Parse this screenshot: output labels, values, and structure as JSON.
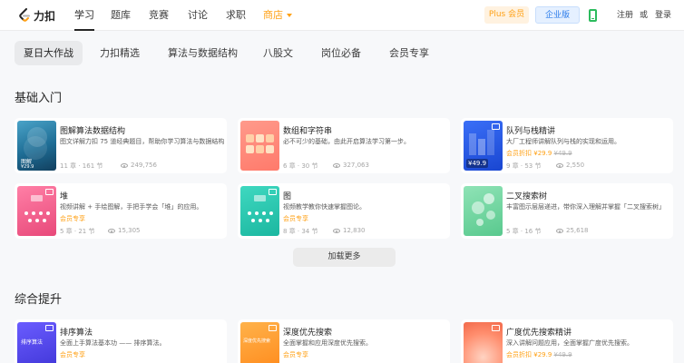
{
  "brand": {
    "name": "力扣"
  },
  "nav": {
    "items": [
      "学习",
      "题库",
      "竞赛",
      "讨论",
      "求职"
    ],
    "shop_label": "商店",
    "plus_label": "Plus 会员",
    "enterprise_label": "企业版",
    "register_label": "注册",
    "or_label": "或",
    "login_label": "登录"
  },
  "tabs": [
    "夏日大作战",
    "力扣精选",
    "算法与数据结构",
    "八股文",
    "岗位必备",
    "会员专享"
  ],
  "sections": {
    "basics_title": "基础入门",
    "advanced_title": "综合提升",
    "load_more_label": "加载更多"
  },
  "cards_basics": [
    {
      "title": "图解算法数据结构",
      "desc": "图文详解力扣 75 道经典题目，帮助你学习算法与数据结构",
      "meta": "11 章 · 161 节",
      "views": "249,756",
      "thumb_label": "图解",
      "thumb_price": "¥29.9"
    },
    {
      "title": "数组和字符串",
      "desc": "必不可少的基础，由此开启算法学习第一步。",
      "meta": "6 章 · 30 节",
      "views": "327,063"
    },
    {
      "title": "队列与栈精讲",
      "desc": "大厂工程师讲解队列与栈的实现和运用。",
      "tag_prefix": "会员折扣 ",
      "tag_price": "¥29.9",
      "tag_old": "¥49.9",
      "meta": "9 章 · 53 节",
      "views": "2,550",
      "thumb_price": "¥49.9"
    },
    {
      "title": "堆",
      "desc": "视频讲解 + 手绘图解，手把手学会「堆」的应用。",
      "tag": "会员专享",
      "meta": "5 章 · 21 节",
      "views": "15,305"
    },
    {
      "title": "图",
      "desc": "视频教学教你快速掌握图论。",
      "tag": "会员专享",
      "meta": "8 章 · 34 节",
      "views": "12,830"
    },
    {
      "title": "二叉搜索树",
      "desc": "丰富图示层层递进，带你深入理解并掌握「二叉搜索树」",
      "meta": "5 章 · 16 节",
      "views": "25,618"
    }
  ],
  "cards_advanced": [
    {
      "title": "排序算法",
      "desc": "全面上手算法基本功 —— 排序算法。",
      "tag": "会员专享",
      "thumb_label": "排序算法"
    },
    {
      "title": "深度优先搜索",
      "desc": "全面掌握和应用深度优先搜索。",
      "tag": "会员专享",
      "thumb_label": "深度优先搜索"
    },
    {
      "title": "广度优先搜索精讲",
      "desc": "深入讲解问题应用，全面掌握广度优先搜索。",
      "tag_prefix": "会员折扣 ",
      "tag_price": "¥29.9",
      "tag_old": "¥49.9"
    }
  ],
  "colors": {
    "accent": "#ffa116",
    "brand_blue": "#2a7bea",
    "success": "#2cbb5d"
  }
}
